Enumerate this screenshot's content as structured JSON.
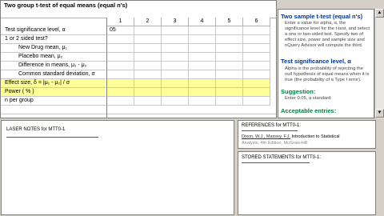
{
  "grid": {
    "title": "Two group t-test of equal means (equal n's)",
    "columns": [
      "1",
      "2",
      "3",
      "4",
      "5",
      "6"
    ],
    "rows": [
      {
        "label": "Test significance level, α",
        "values": [
          "05",
          "",
          "",
          "",
          "",
          ""
        ]
      },
      {
        "label": "1 or 2 sided test?",
        "values": [
          "",
          "",
          "",
          "",
          "",
          ""
        ]
      },
      {
        "label": "New Drug mean, μ₁",
        "values": [
          "",
          "",
          "",
          "",
          "",
          ""
        ]
      },
      {
        "label": "Placebo mean, μ₂",
        "values": [
          "",
          "",
          "",
          "",
          "",
          ""
        ]
      },
      {
        "label": "Difference in means, μ₁ - μ₂",
        "values": [
          "",
          "",
          "",
          "",
          "",
          ""
        ]
      },
      {
        "label": "Common standard deviation, σ",
        "values": [
          "",
          "",
          "",
          "",
          "",
          ""
        ]
      },
      {
        "label": "Effect size, δ = |μ₁ - μ₂| / σ",
        "values": [
          "",
          "",
          "",
          "",
          "",
          ""
        ]
      },
      {
        "label": "Power ( % )",
        "values": [
          "",
          "",
          "",
          "",
          "",
          ""
        ]
      },
      {
        "label": "n per group",
        "values": [
          "",
          "",
          "",
          "",
          "",
          ""
        ]
      }
    ]
  },
  "help": {
    "title": "Two sample t-test (equal n's)",
    "intro": "Enter a value for alpha, α, the significance level for the t-test, and select a one or two-sided test. Specify two of effect size, power and sample size and nQuery Advisor will compute the third.",
    "section": "Test significance level, α",
    "section_text": "Alpha is the probability of rejecting the null hypothesis of equal means when it is true (the probability of a Type I error).",
    "suggestion_label": "Suggestion:",
    "suggestion_text": "Enter 0.05, a standard",
    "acceptable_label": "Acceptable entries:"
  },
  "notes": {
    "title": "LASER NOTES for MTT0-1"
  },
  "references": {
    "title": "REFERENCES for MTT0-1:",
    "entry_prefix": "Dixon, W.J., Massey, F.J.",
    "entry_title": "Introduction to Statistical",
    "entry_more": "Analysis, 4th Edition, McGraw-Hill"
  },
  "stored": {
    "title": "STORED STATEMENTS for MTT0-1:"
  },
  "colors": {
    "yellow": "#ffff99",
    "heading": "#003399",
    "green": "#008040"
  }
}
